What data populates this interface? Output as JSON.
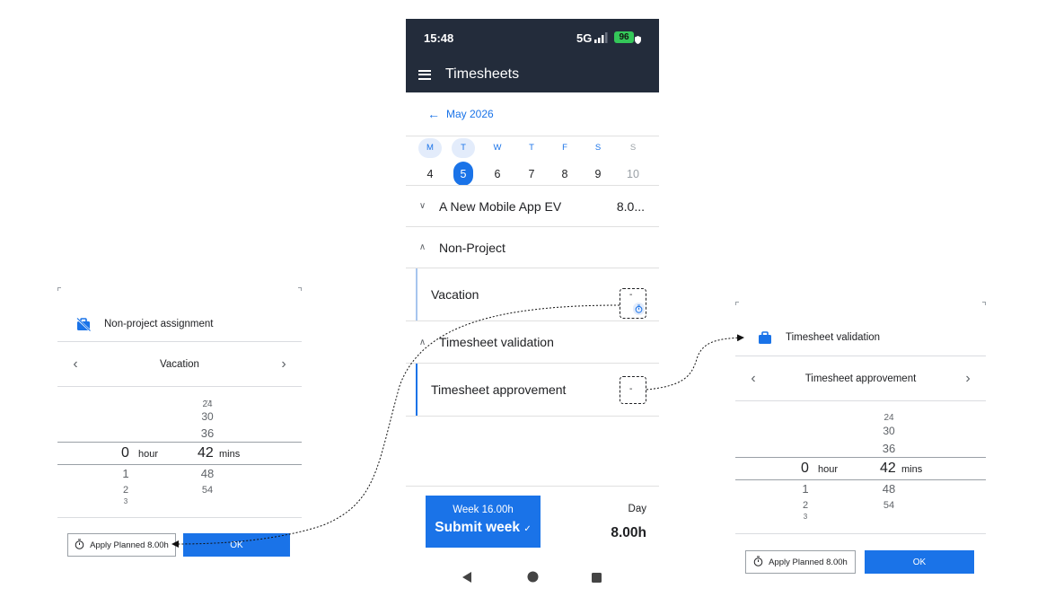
{
  "left_dialog": {
    "header": "Non-project assignment",
    "header_icon": "briefcase-off-icon",
    "nav_label": "Vacation",
    "picker": {
      "min_above": [
        "...",
        "24",
        "30",
        "36"
      ],
      "hour_value": "0",
      "hour_unit": "hour",
      "min_value": "42",
      "min_unit": "mins",
      "hour_below": [
        "1",
        "2",
        "3"
      ],
      "min_below": [
        "48",
        "54"
      ]
    },
    "apply_label": "Apply Planned 8.00h",
    "ok_label": "OK"
  },
  "phone": {
    "status": {
      "time": "15:48",
      "network": "5G",
      "battery": "96"
    },
    "app_title": "Timesheets",
    "month": "May 2026",
    "days": [
      {
        "letter": "M",
        "num": "4"
      },
      {
        "letter": "T",
        "num": "5"
      },
      {
        "letter": "W",
        "num": "6"
      },
      {
        "letter": "T",
        "num": "7"
      },
      {
        "letter": "F",
        "num": "8"
      },
      {
        "letter": "S",
        "num": "9"
      },
      {
        "letter": "S",
        "num": "10"
      }
    ],
    "project": {
      "name": "A New Mobile App EV",
      "hours": "8.0..."
    },
    "non_project": {
      "title": "Non-Project",
      "entry": "Vacation",
      "value": "-"
    },
    "validation": {
      "title": "Timesheet validation",
      "entry": "Timesheet approvement",
      "value": "-"
    },
    "footer": {
      "week": "Week 16.00h",
      "submit": "Submit week",
      "day_label": "Day",
      "day_hours": "8.00h"
    }
  },
  "right_dialog": {
    "header": "Timesheet validation",
    "header_icon": "briefcase-icon",
    "nav_label": "Timesheet approvement",
    "picker": {
      "min_above": [
        "24",
        "30",
        "36"
      ],
      "hour_value": "0",
      "hour_unit": "hour",
      "min_value": "42",
      "min_unit": "mins",
      "hour_below": [
        "1",
        "2",
        "3"
      ],
      "min_below": [
        "48",
        "54"
      ]
    },
    "apply_label": "Apply Planned 8.00h",
    "ok_label": "OK"
  },
  "colors": {
    "primary": "#1a73e8",
    "appbar": "#232c3b",
    "battery": "#34c759"
  }
}
